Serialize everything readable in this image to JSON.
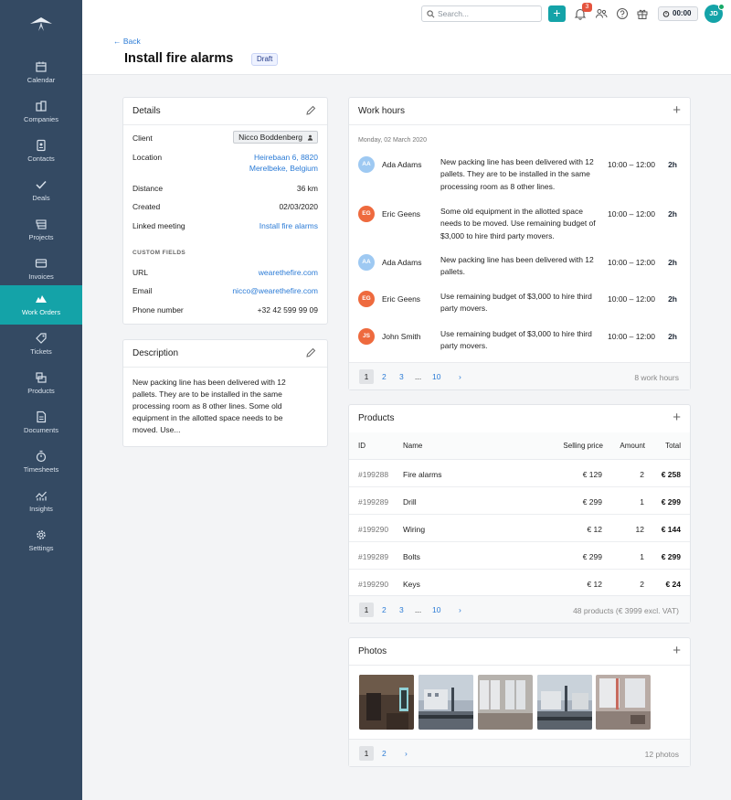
{
  "sidebar": {
    "items": [
      {
        "label": "Calendar",
        "icon": "calendar-icon"
      },
      {
        "label": "Companies",
        "icon": "companies-icon"
      },
      {
        "label": "Contacts",
        "icon": "contacts-icon"
      },
      {
        "label": "Deals",
        "icon": "check-icon"
      },
      {
        "label": "Projects",
        "icon": "projects-icon"
      },
      {
        "label": "Invoices",
        "icon": "invoices-icon"
      },
      {
        "label": "Work Orders",
        "icon": "work-orders-icon"
      },
      {
        "label": "Tickets",
        "icon": "tag-icon"
      },
      {
        "label": "Products",
        "icon": "products-icon"
      },
      {
        "label": "Documents",
        "icon": "documents-icon"
      },
      {
        "label": "Timesheets",
        "icon": "stopwatch-icon"
      },
      {
        "label": "Insights",
        "icon": "insights-icon"
      },
      {
        "label": "Settings",
        "icon": "gear-icon"
      }
    ],
    "active": "Work Orders"
  },
  "topbar": {
    "search_placeholder": "Search...",
    "notification_count": "3",
    "timer": "00:00",
    "avatar_initials": "JD",
    "colors": {
      "accent": "#14a3a8",
      "badge": "#e5533d",
      "online": "#17a968"
    }
  },
  "header": {
    "back_label": "← Back",
    "title": "Install fire alarms",
    "status": "Draft"
  },
  "details": {
    "title": "Details",
    "client_label": "Client",
    "client_value": "Nicco Boddenberg",
    "location_label": "Location",
    "location_line1": "Heirebaan 6, 8820",
    "location_line2": "Merelbeke, Belgium",
    "distance_label": "Distance",
    "distance_value": "36 km",
    "created_label": "Created",
    "created_value": "02/03/2020",
    "meeting_label": "Linked meeting",
    "meeting_value": "Install fire alarms",
    "custom_fields_label": "CUSTOM FIELDS",
    "url_label": "URL",
    "url_value": "wearethefire.com",
    "email_label": "Email",
    "email_value": "nicco@wearethefire.com",
    "phone_label": "Phone number",
    "phone_value": "+32 42 599 99 09"
  },
  "description": {
    "title": "Description",
    "text": "New packing line has been delivered with 12 pallets. They are to be installed in the same processing room as 8 other lines. Some old equipment in the allotted space needs to be moved. Use..."
  },
  "work_hours": {
    "title": "Work hours",
    "date": "Monday, 02 March 2020",
    "entries": [
      {
        "initials": "AA",
        "name": "Ada Adams",
        "text": "New packing line has been delivered with 12 pallets. They are to be installed in the same processing room as 8 other lines.",
        "time": "10:00 – 12:00",
        "hours": "2h",
        "color": "#9ec9f2"
      },
      {
        "initials": "EG",
        "name": "Eric Geens",
        "text": "Some old equipment in the allotted space needs to be moved. Use remaining budget of $3,000 to hire third party movers.",
        "time": "10:00 – 12:00",
        "hours": "2h",
        "color": "#ee6a3e"
      },
      {
        "initials": "AA",
        "name": "Ada Adams",
        "text": "New packing line has been delivered with 12 pallets.",
        "time": "10:00 – 12:00",
        "hours": "2h",
        "color": "#9ec9f2"
      },
      {
        "initials": "EG",
        "name": "Eric Geens",
        "text": "Use remaining budget of $3,000 to hire third party movers.",
        "time": "10:00 – 12:00",
        "hours": "2h",
        "color": "#ee6a3e"
      },
      {
        "initials": "JS",
        "name": "John Smith",
        "text": "Use remaining budget of $3,000 to hire third party movers.",
        "time": "10:00 – 12:00",
        "hours": "2h",
        "color": "#ee6a3e"
      }
    ],
    "pagination": [
      "1",
      "2",
      "3",
      "...",
      "10",
      "›"
    ],
    "footer_info": "8 work hours"
  },
  "products": {
    "title": "Products",
    "columns": [
      "ID",
      "Name",
      "Selling price",
      "Amount",
      "Total"
    ],
    "rows": [
      {
        "id": "#199288",
        "name": "Fire alarms",
        "price": "€ 129",
        "amount": "2",
        "total": "€ 258"
      },
      {
        "id": "#199289",
        "name": "Drill",
        "price": "€ 299",
        "amount": "1",
        "total": "€ 299"
      },
      {
        "id": "#199290",
        "name": "Wiring",
        "price": "€ 12",
        "amount": "12",
        "total": "€ 144"
      },
      {
        "id": "#199289",
        "name": "Bolts",
        "price": "€ 299",
        "amount": "1",
        "total": "€ 299"
      },
      {
        "id": "#199290",
        "name": "Keys",
        "price": "€ 12",
        "amount": "2",
        "total": "€ 24"
      }
    ],
    "pagination": [
      "1",
      "2",
      "3",
      "...",
      "10",
      "›"
    ],
    "footer_info": "48 products (€ 3999 excl. VAT)"
  },
  "photos": {
    "title": "Photos",
    "thumbnails": [
      "photo-1",
      "photo-2",
      "photo-3",
      "photo-4",
      "photo-5"
    ],
    "pagination": [
      "1",
      "2",
      "›"
    ],
    "footer_info": "12 photos"
  }
}
